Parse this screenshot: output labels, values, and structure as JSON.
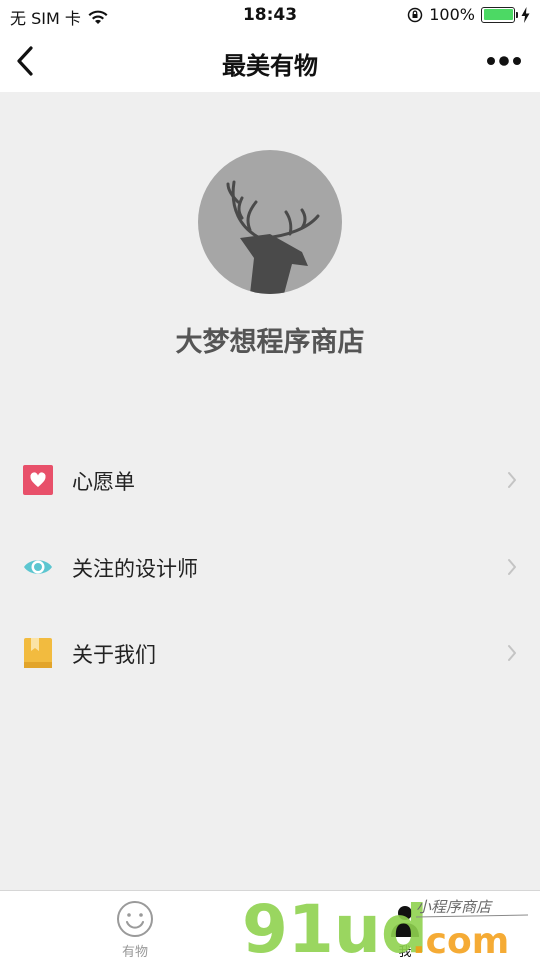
{
  "status_bar": {
    "carrier": "无 SIM 卡",
    "time": "18:43",
    "battery_percent": "100%",
    "battery_level": 1.0
  },
  "nav": {
    "title": "最美有物",
    "back_icon": "chevron-left-icon",
    "more_icon": "more-dots-icon"
  },
  "profile": {
    "avatar_icon": "deer-icon",
    "store_name": "大梦想程序商店"
  },
  "menu": [
    {
      "label": "心愿单",
      "icon": "heart-icon",
      "color": "#e8506a"
    },
    {
      "label": "关注的设计师",
      "icon": "eye-icon",
      "color": "#5cc6d0"
    },
    {
      "label": "关于我们",
      "icon": "book-icon",
      "color": "#f2bb3f"
    }
  ],
  "tabs": [
    {
      "label": "有物",
      "icon": "smiley-icon",
      "active": false
    },
    {
      "label": "我",
      "icon": "person-icon",
      "active": true
    }
  ],
  "watermark": {
    "brand": "91ud",
    "domain": ".com",
    "tagline": "小程序商店",
    "colors": {
      "green": "#8fd14f",
      "orange": "#f39c12"
    }
  }
}
